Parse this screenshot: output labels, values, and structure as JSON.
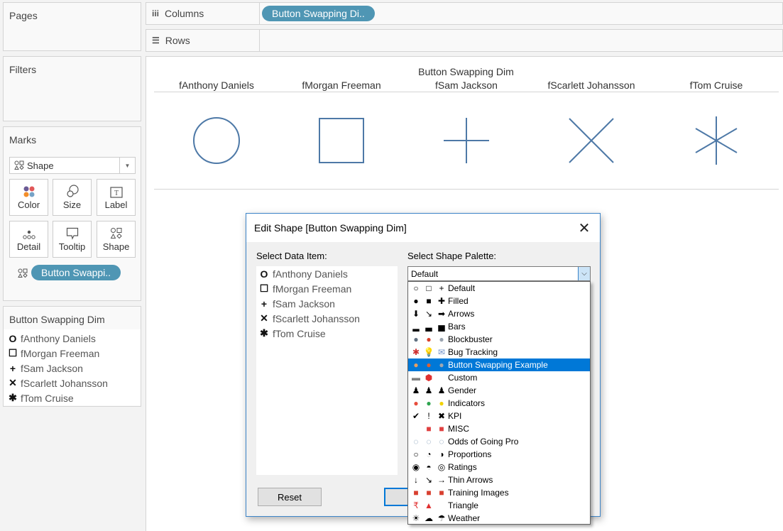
{
  "panels": {
    "pages": "Pages",
    "filters": "Filters",
    "marks": "Marks"
  },
  "shelves": {
    "columns_label": "Columns",
    "rows_label": "Rows",
    "columns_pill": "Button Swapping Di.."
  },
  "marks_card": {
    "mark_type": "Shape",
    "buttons": [
      "Color",
      "Size",
      "Label",
      "Detail",
      "Tooltip",
      "Shape"
    ],
    "shape_pill": "Button Swappi.."
  },
  "legend": {
    "title": "Button Swapping Dim",
    "items": [
      {
        "glyph": "circle",
        "symbol": "O",
        "label": "fAnthony Daniels"
      },
      {
        "glyph": "square",
        "symbol": "☐",
        "label": "fMorgan Freeman"
      },
      {
        "glyph": "plus",
        "symbol": "+",
        "label": "fSam Jackson"
      },
      {
        "glyph": "cross",
        "symbol": "✕",
        "label": "fScarlett Johansson"
      },
      {
        "glyph": "asterisk",
        "symbol": "✱",
        "label": "fTom Cruise"
      }
    ]
  },
  "viz": {
    "dimension_title": "Button Swapping Dim",
    "columns": [
      {
        "header": "fAnthony Daniels",
        "shape": "circle"
      },
      {
        "header": "fMorgan Freeman",
        "shape": "square"
      },
      {
        "header": "fSam Jackson",
        "shape": "plus"
      },
      {
        "header": "fScarlett Johansson",
        "shape": "cross"
      },
      {
        "header": "fTom Cruise",
        "shape": "asterisk"
      }
    ],
    "mark_color": "#4e79a7"
  },
  "dialog": {
    "title": "Edit Shape [Button Swapping Dim]",
    "select_data_label": "Select Data Item:",
    "select_palette_label": "Select Shape Palette:",
    "palette_value": "Default",
    "reset_label": "Reset",
    "data_items": [
      {
        "symbol": "O",
        "label": "fAnthony Daniels"
      },
      {
        "symbol": "☐",
        "label": "fMorgan Freeman"
      },
      {
        "symbol": "+",
        "label": "fSam Jackson"
      },
      {
        "symbol": "✕",
        "label": "fScarlett Johansson"
      },
      {
        "symbol": "✱",
        "label": "fTom Cruise"
      }
    ],
    "palettes": [
      {
        "label": "Default",
        "icons": [
          "○",
          "□",
          "+"
        ]
      },
      {
        "label": "Filled",
        "icons": [
          "●",
          "■",
          "✚"
        ]
      },
      {
        "label": "Arrows",
        "icons": [
          "⬇",
          "↘",
          "➡"
        ]
      },
      {
        "label": "Bars",
        "icons": [
          "▂",
          "▃",
          "▅"
        ]
      },
      {
        "label": "Blockbuster",
        "icons": [
          "●",
          "●",
          "●"
        ]
      },
      {
        "label": "Bug Tracking",
        "icons": [
          "✱",
          "💡",
          "✉"
        ]
      },
      {
        "label": "Button Swapping Example",
        "icons": [
          "●",
          "●",
          "●"
        ],
        "selected": true
      },
      {
        "label": "Custom",
        "icons": [
          "▬",
          "⬢",
          ""
        ]
      },
      {
        "label": "Gender",
        "icons": [
          "♟",
          "♟",
          "♟"
        ]
      },
      {
        "label": "Indicators",
        "icons": [
          "●",
          "●",
          "●"
        ]
      },
      {
        "label": "KPI",
        "icons": [
          "✔",
          "!",
          "✖"
        ]
      },
      {
        "label": "MISC",
        "icons": [
          "",
          "■",
          "■"
        ]
      },
      {
        "label": "Odds of Going Pro",
        "icons": [
          "◌",
          "◌",
          "◌"
        ]
      },
      {
        "label": "Proportions",
        "icons": [
          "○",
          "◔",
          "◑"
        ]
      },
      {
        "label": "Ratings",
        "icons": [
          "◉",
          "◓",
          "◎"
        ]
      },
      {
        "label": "Thin Arrows",
        "icons": [
          "↓",
          "↘",
          "→"
        ]
      },
      {
        "label": "Training Images",
        "icons": [
          "■",
          "■",
          "■"
        ]
      },
      {
        "label": "Triangle",
        "icons": [
          "₹",
          "▲",
          ""
        ]
      },
      {
        "label": "Weather",
        "icons": [
          "☀",
          "☁",
          "☂"
        ]
      }
    ],
    "palette_icon_colors": {
      "Blockbuster": [
        "#607080",
        "#d9412a",
        "#9aa4b0"
      ],
      "Bug Tracking": [
        "#d03030",
        "#f2d24a",
        "#6f8fc6"
      ],
      "Button Swapping Example": [
        "#e8a060",
        "#e06030",
        "#a0a8b0"
      ],
      "Custom": [
        "#808080",
        "#e03030",
        "#000000"
      ],
      "Indicators": [
        "#e74c3c",
        "#2ea44f",
        "#f2d200"
      ],
      "MISC": [
        "#000000",
        "#e04040",
        "#e04040"
      ],
      "Odds of Going Pro": [
        "#6a88a8",
        "#6a88a8",
        "#6a88a8"
      ],
      "Training Images": [
        "#d84030",
        "#d84030",
        "#d84030"
      ],
      "Triangle": [
        "#e03030",
        "#e03030",
        "#000000"
      ]
    }
  }
}
